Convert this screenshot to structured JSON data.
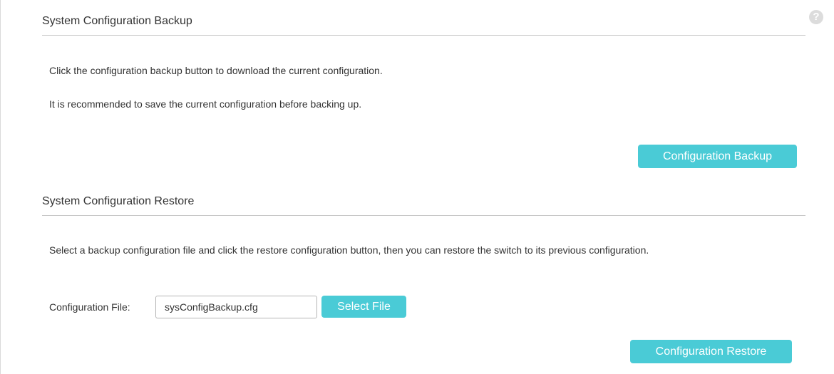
{
  "help": {
    "icon": "help-question-icon",
    "glyph": "?"
  },
  "backup": {
    "title": "System Configuration Backup",
    "description_1": "Click the configuration backup button to download the current configuration.",
    "description_2": "It is recommended to save the current configuration before backing up.",
    "button_label": "Configuration Backup"
  },
  "restore": {
    "title": "System Configuration Restore",
    "description": "Select a backup configuration file and click the restore configuration button, then you can restore the switch to its previous configuration.",
    "file_label": "Configuration File:",
    "file_value": "sysConfigBackup.cfg",
    "select_button_label": "Select File",
    "button_label": "Configuration Restore"
  },
  "colors": {
    "accent": "#4acbd6",
    "divider": "#c8c8c8",
    "text": "#333333"
  }
}
